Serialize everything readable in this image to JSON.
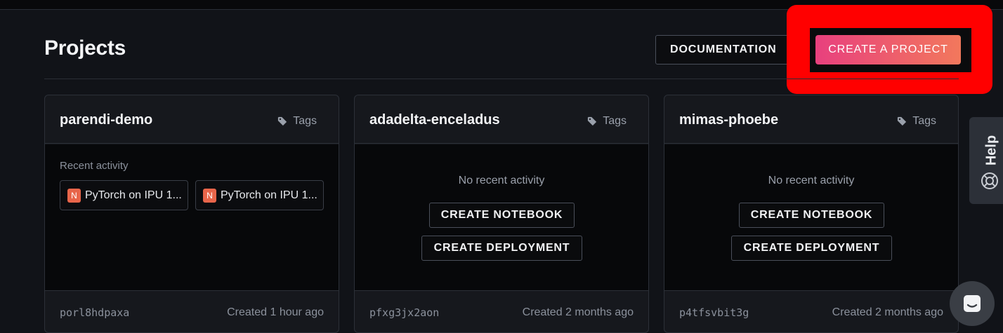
{
  "page": {
    "title": "Projects"
  },
  "header": {
    "documentation_label": "DOCUMENTATION",
    "documentation_icon": "external-link-icon",
    "create_project_label": "CREATE A PROJECT"
  },
  "projects": [
    {
      "name": "parendi-demo",
      "tags_label": "Tags",
      "recent_label": "Recent activity",
      "activity": [
        {
          "badge": "N",
          "label": "PyTorch on IPU 1..."
        },
        {
          "badge": "N",
          "label": "PyTorch on IPU 1..."
        }
      ],
      "id": "porl8hdpaxa",
      "created": "Created 1 hour ago"
    },
    {
      "name": "adadelta-enceladus",
      "tags_label": "Tags",
      "no_activity": "No recent activity",
      "create_notebook": "CREATE NOTEBOOK",
      "create_deployment": "CREATE DEPLOYMENT",
      "id": "pfxg3jx2aon",
      "created": "Created 2 months ago"
    },
    {
      "name": "mimas-phoebe",
      "tags_label": "Tags",
      "no_activity": "No recent activity",
      "create_notebook": "CREATE NOTEBOOK",
      "create_deployment": "CREATE DEPLOYMENT",
      "id": "p4tfsvbit3g",
      "created": "Created 2 months ago"
    }
  ],
  "help": {
    "label": "Help"
  },
  "colors": {
    "highlight": "#ff0000",
    "create_gradient_start": "#e8407e",
    "create_gradient_end": "#f2785c"
  }
}
